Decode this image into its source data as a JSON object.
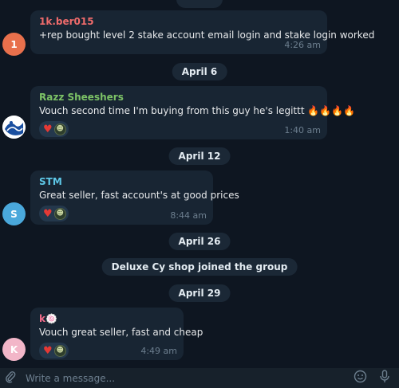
{
  "colors": {
    "background": "#0e1621",
    "bubble": "#182533",
    "pill": "#1b2836",
    "time": "#6d7f8f",
    "input_bar": "#17212b"
  },
  "messages": [
    {
      "sender": "1k.ber015",
      "sender_color": "#ef6b6b",
      "avatar_letter": "1",
      "avatar_color": "#e8704c",
      "text": "+rep bought level 2 stake account email login and stake login worked",
      "time": "4:26 am"
    },
    {
      "sender": "Razz Sheeshers",
      "sender_color": "#7cc266",
      "avatar_icon": "wave-logo-icon",
      "text": "Vouch second time I'm buying from this guy he's legittt 🔥🔥🔥🔥",
      "time": "1:40 am",
      "reactions": [
        "heart",
        "user-avatar"
      ]
    },
    {
      "sender": "STM",
      "sender_color": "#5ec8e8",
      "avatar_letter": "S",
      "avatar_color": "#4aa8db",
      "text": "Great seller, fast account's at good prices",
      "time": "8:44 am",
      "reactions": [
        "heart",
        "user-avatar"
      ]
    },
    {
      "sender": "k🍥",
      "sender_color": "#ef6b8a",
      "avatar_letter": "K",
      "avatar_color": "#f2b6c8",
      "text": "Vouch great seller, fast and cheap",
      "time": "4:49 am",
      "reactions": [
        "heart",
        "user-avatar"
      ]
    }
  ],
  "dates": {
    "d0": "",
    "d1": "April 6",
    "d2": "April 12",
    "d3": "April 26",
    "d4": "April 29"
  },
  "service": "Deluxe Cy shop joined the group",
  "input": {
    "placeholder": "Write a message...",
    "attach_icon": "paperclip-icon",
    "emoji_icon": "emoji-icon",
    "mic_icon": "microphone-icon"
  }
}
